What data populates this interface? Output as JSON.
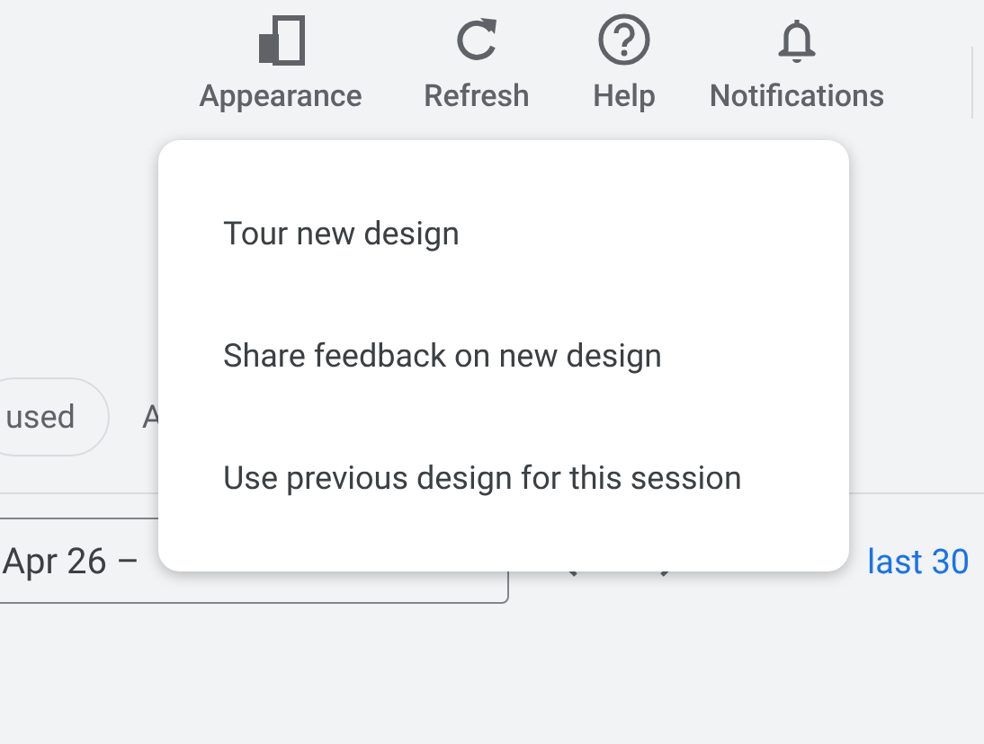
{
  "toolbar": [
    {
      "label": "Appearance",
      "kind": "appearance"
    },
    {
      "label": "Refresh",
      "kind": "refresh"
    },
    {
      "label": "Help",
      "kind": "help"
    },
    {
      "label": "Notifications",
      "kind": "bell"
    }
  ],
  "filters": [
    {
      "label": "used"
    },
    {
      "label": "A"
    }
  ],
  "date_range": {
    "value": "Apr 26 –"
  },
  "link": "last 30",
  "menu": {
    "items": [
      {
        "label": "Tour new design"
      },
      {
        "label": "Share feedback on new design"
      },
      {
        "label": "Use previous design for this session"
      }
    ]
  }
}
